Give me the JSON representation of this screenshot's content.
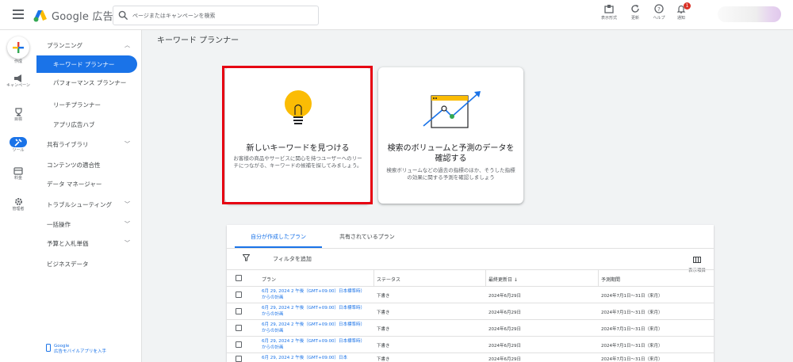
{
  "header": {
    "logo_text": "Google 広告",
    "search_placeholder": "ページまたはキャンペーンを検索",
    "tools": [
      {
        "label": "表示形式",
        "icon": "display-format-icon"
      },
      {
        "label": "更新",
        "icon": "refresh-icon"
      },
      {
        "label": "ヘルプ",
        "icon": "help-icon"
      },
      {
        "label": "通知",
        "icon": "notification-bell-icon"
      }
    ],
    "notification_count": "1"
  },
  "rail": {
    "items": [
      {
        "label": "作成",
        "icon": "create-plus-icon"
      },
      {
        "label": "キャンペーン",
        "icon": "campaign-megaphone-icon"
      },
      {
        "label": "目標",
        "icon": "goals-trophy-icon"
      },
      {
        "label": "ツール",
        "icon": "tools-icon",
        "active": true
      },
      {
        "label": "料金",
        "icon": "billing-icon"
      },
      {
        "label": "管理者",
        "icon": "admin-gear-icon"
      }
    ]
  },
  "nav": {
    "planning": "プランニング",
    "items": [
      "キーワード プランナー",
      "パフォーマンス プランナー",
      "リーチプランナー",
      "アプリ広告ハブ"
    ],
    "sections": [
      "共有ライブラリ",
      "コンテンツの適合性",
      "データ マネージャー",
      "トラブルシューティング",
      "一括操作",
      "予算と入札単価",
      "ビジネスデータ"
    ],
    "footer": "Google\n広告モバイルアプリを入手"
  },
  "main": {
    "title": "キーワード プランナー",
    "cards": [
      {
        "title": "新しいキーワードを見つける",
        "desc": "お客様の商品やサービスに関心を持つユーザーへのリーチにつながる、キーワードの候補を探してみましょう。"
      },
      {
        "title": "検索のボリュームと予測のデータを確認する",
        "desc": "検索ボリュームなどの過去の指標のほか、そうした指標の効果に関する予測を確認しましょう"
      }
    ]
  },
  "table": {
    "tabs": [
      "自分が作成したプラン",
      "共有されているプラン"
    ],
    "filter": "フィルタを追加",
    "columns_button": "表示項目",
    "headers": [
      "プラン",
      "ステータス",
      "最終更新日 ↓",
      "予測期間"
    ],
    "rows": [
      {
        "plan": "6月 29, 2024 2 午後（GMT+09:00）日本標準時）からの計画",
        "status": "下書き",
        "updated": "2024年6月29日",
        "period": "2024年7月1日～31日（来月）"
      },
      {
        "plan": "6月 29, 2024 2 午後（GMT+09:00）日本標準時）からの計画",
        "status": "下書き",
        "updated": "2024年6月29日",
        "period": "2024年7月1日～31日（来月）"
      },
      {
        "plan": "6月 29, 2024 2 午後（GMT+09:00）日本標準時）からの計画",
        "status": "下書き",
        "updated": "2024年6月29日",
        "period": "2024年7月1日～31日（来月）"
      },
      {
        "plan": "6月 29, 2024 2 午後（GMT+09:00）日本標準時）からの計画",
        "status": "下書き",
        "updated": "2024年6月29日",
        "period": "2024年7月1日～31日（来月）"
      },
      {
        "plan": "6月 29, 2024 2 午後（GMT+09:00）日本",
        "status": "下書き",
        "updated": "2024年6月29日",
        "period": "2024年7月1日～31日（来月）"
      }
    ]
  },
  "colors": {
    "accent": "#1a73e8",
    "highlight": "#e60012",
    "bulb": "#fbbc04"
  }
}
